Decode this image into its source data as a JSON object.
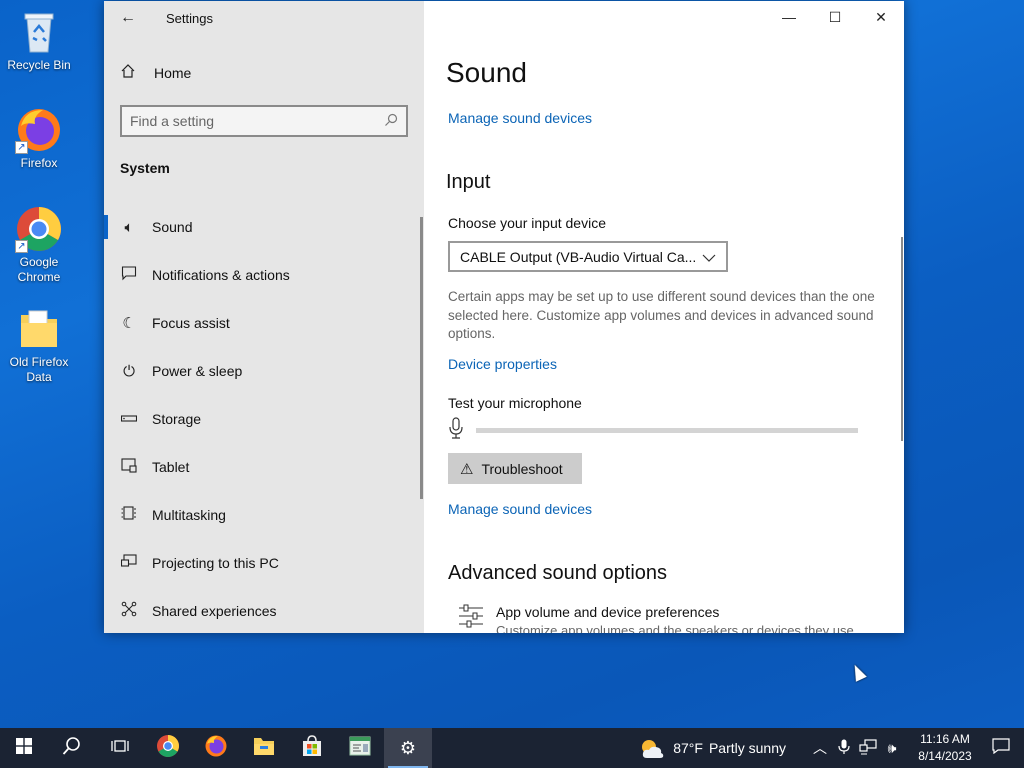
{
  "desktop": {
    "icons": [
      {
        "label": "Recycle Bin"
      },
      {
        "label": "Firefox"
      },
      {
        "label": "Google Chrome"
      },
      {
        "label": "Old Firefox Data"
      }
    ]
  },
  "window": {
    "title": "Settings",
    "controls": {
      "minimize": "—",
      "maximize": "☐",
      "close": "✕"
    }
  },
  "sidebar": {
    "home_label": "Home",
    "search_placeholder": "Find a setting",
    "section_label": "System",
    "items": [
      {
        "label": "Sound",
        "icon": "speaker-icon"
      },
      {
        "label": "Notifications & actions",
        "icon": "notification-icon"
      },
      {
        "label": "Focus assist",
        "icon": "moon-icon"
      },
      {
        "label": "Power & sleep",
        "icon": "power-icon"
      },
      {
        "label": "Storage",
        "icon": "storage-icon"
      },
      {
        "label": "Tablet",
        "icon": "tablet-icon"
      },
      {
        "label": "Multitasking",
        "icon": "multitasking-icon"
      },
      {
        "label": "Projecting to this PC",
        "icon": "projecting-icon"
      },
      {
        "label": "Shared experiences",
        "icon": "shared-icon"
      }
    ],
    "active_item": "Sound"
  },
  "main": {
    "page_title": "Sound",
    "manage_devices_top": "Manage sound devices",
    "input_heading": "Input",
    "choose_input_label": "Choose your input device",
    "input_device_value": "CABLE Output (VB-Audio Virtual Ca...",
    "input_description": "Certain apps may be set up to use different sound devices than the one selected here. Customize app volumes and devices in advanced sound options.",
    "device_properties_link": "Device properties",
    "test_mic_label": "Test your microphone",
    "mic_level": 0,
    "troubleshoot_label": "Troubleshoot",
    "manage_devices_bottom": "Manage sound devices",
    "advanced_heading": "Advanced sound options",
    "app_volume_title": "App volume and device preferences",
    "app_volume_subtitle": "Customize app volumes and the speakers or devices they use."
  },
  "taskbar": {
    "weather_temp": "87°F",
    "weather_text": "Partly sunny",
    "time": "11:16 AM",
    "date": "8/14/2023",
    "colors": {
      "background": "#1b2333",
      "accent": "#7fb6ef"
    }
  }
}
